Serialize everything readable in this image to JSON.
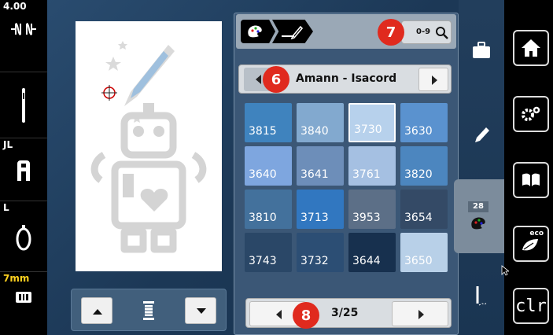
{
  "left_bar": {
    "tension_value": "4.00",
    "foot_label": "JL",
    "hoop_label": "L",
    "stitch_width": "7mm"
  },
  "palette_header": {
    "search_label": "0-9"
  },
  "thread_brand": {
    "name": "Amann - Isacord"
  },
  "swatches": [
    {
      "code": "3815",
      "color": "#3f83be"
    },
    {
      "code": "3840",
      "color": "#82a9cf"
    },
    {
      "code": "3730",
      "color": "#b7d1ec",
      "selected": true
    },
    {
      "code": "3630",
      "color": "#5a92cf"
    },
    {
      "code": "3640",
      "color": "#7ea6df"
    },
    {
      "code": "3641",
      "color": "#6d8eb9"
    },
    {
      "code": "3761",
      "color": "#a5c0e2"
    },
    {
      "code": "3820",
      "color": "#4c86bf"
    },
    {
      "code": "3810",
      "color": "#43719c"
    },
    {
      "code": "3713",
      "color": "#3177c0"
    },
    {
      "code": "3953",
      "color": "#5c6f87"
    },
    {
      "code": "3654",
      "color": "#344a66"
    },
    {
      "code": "3743",
      "color": "#2a4767"
    },
    {
      "code": "3732",
      "color": "#2c4e74"
    },
    {
      "code": "3644",
      "color": "#17304e"
    },
    {
      "code": "3650",
      "color": "#b8d0e8"
    }
  ],
  "pagination": {
    "page_label": "3/25"
  },
  "color_tab": {
    "count": "28"
  },
  "annotations": {
    "badge6": "6",
    "badge7": "7",
    "badge8": "8"
  },
  "right_bar": {
    "clr_label": "clr",
    "eco_label": "eco"
  }
}
